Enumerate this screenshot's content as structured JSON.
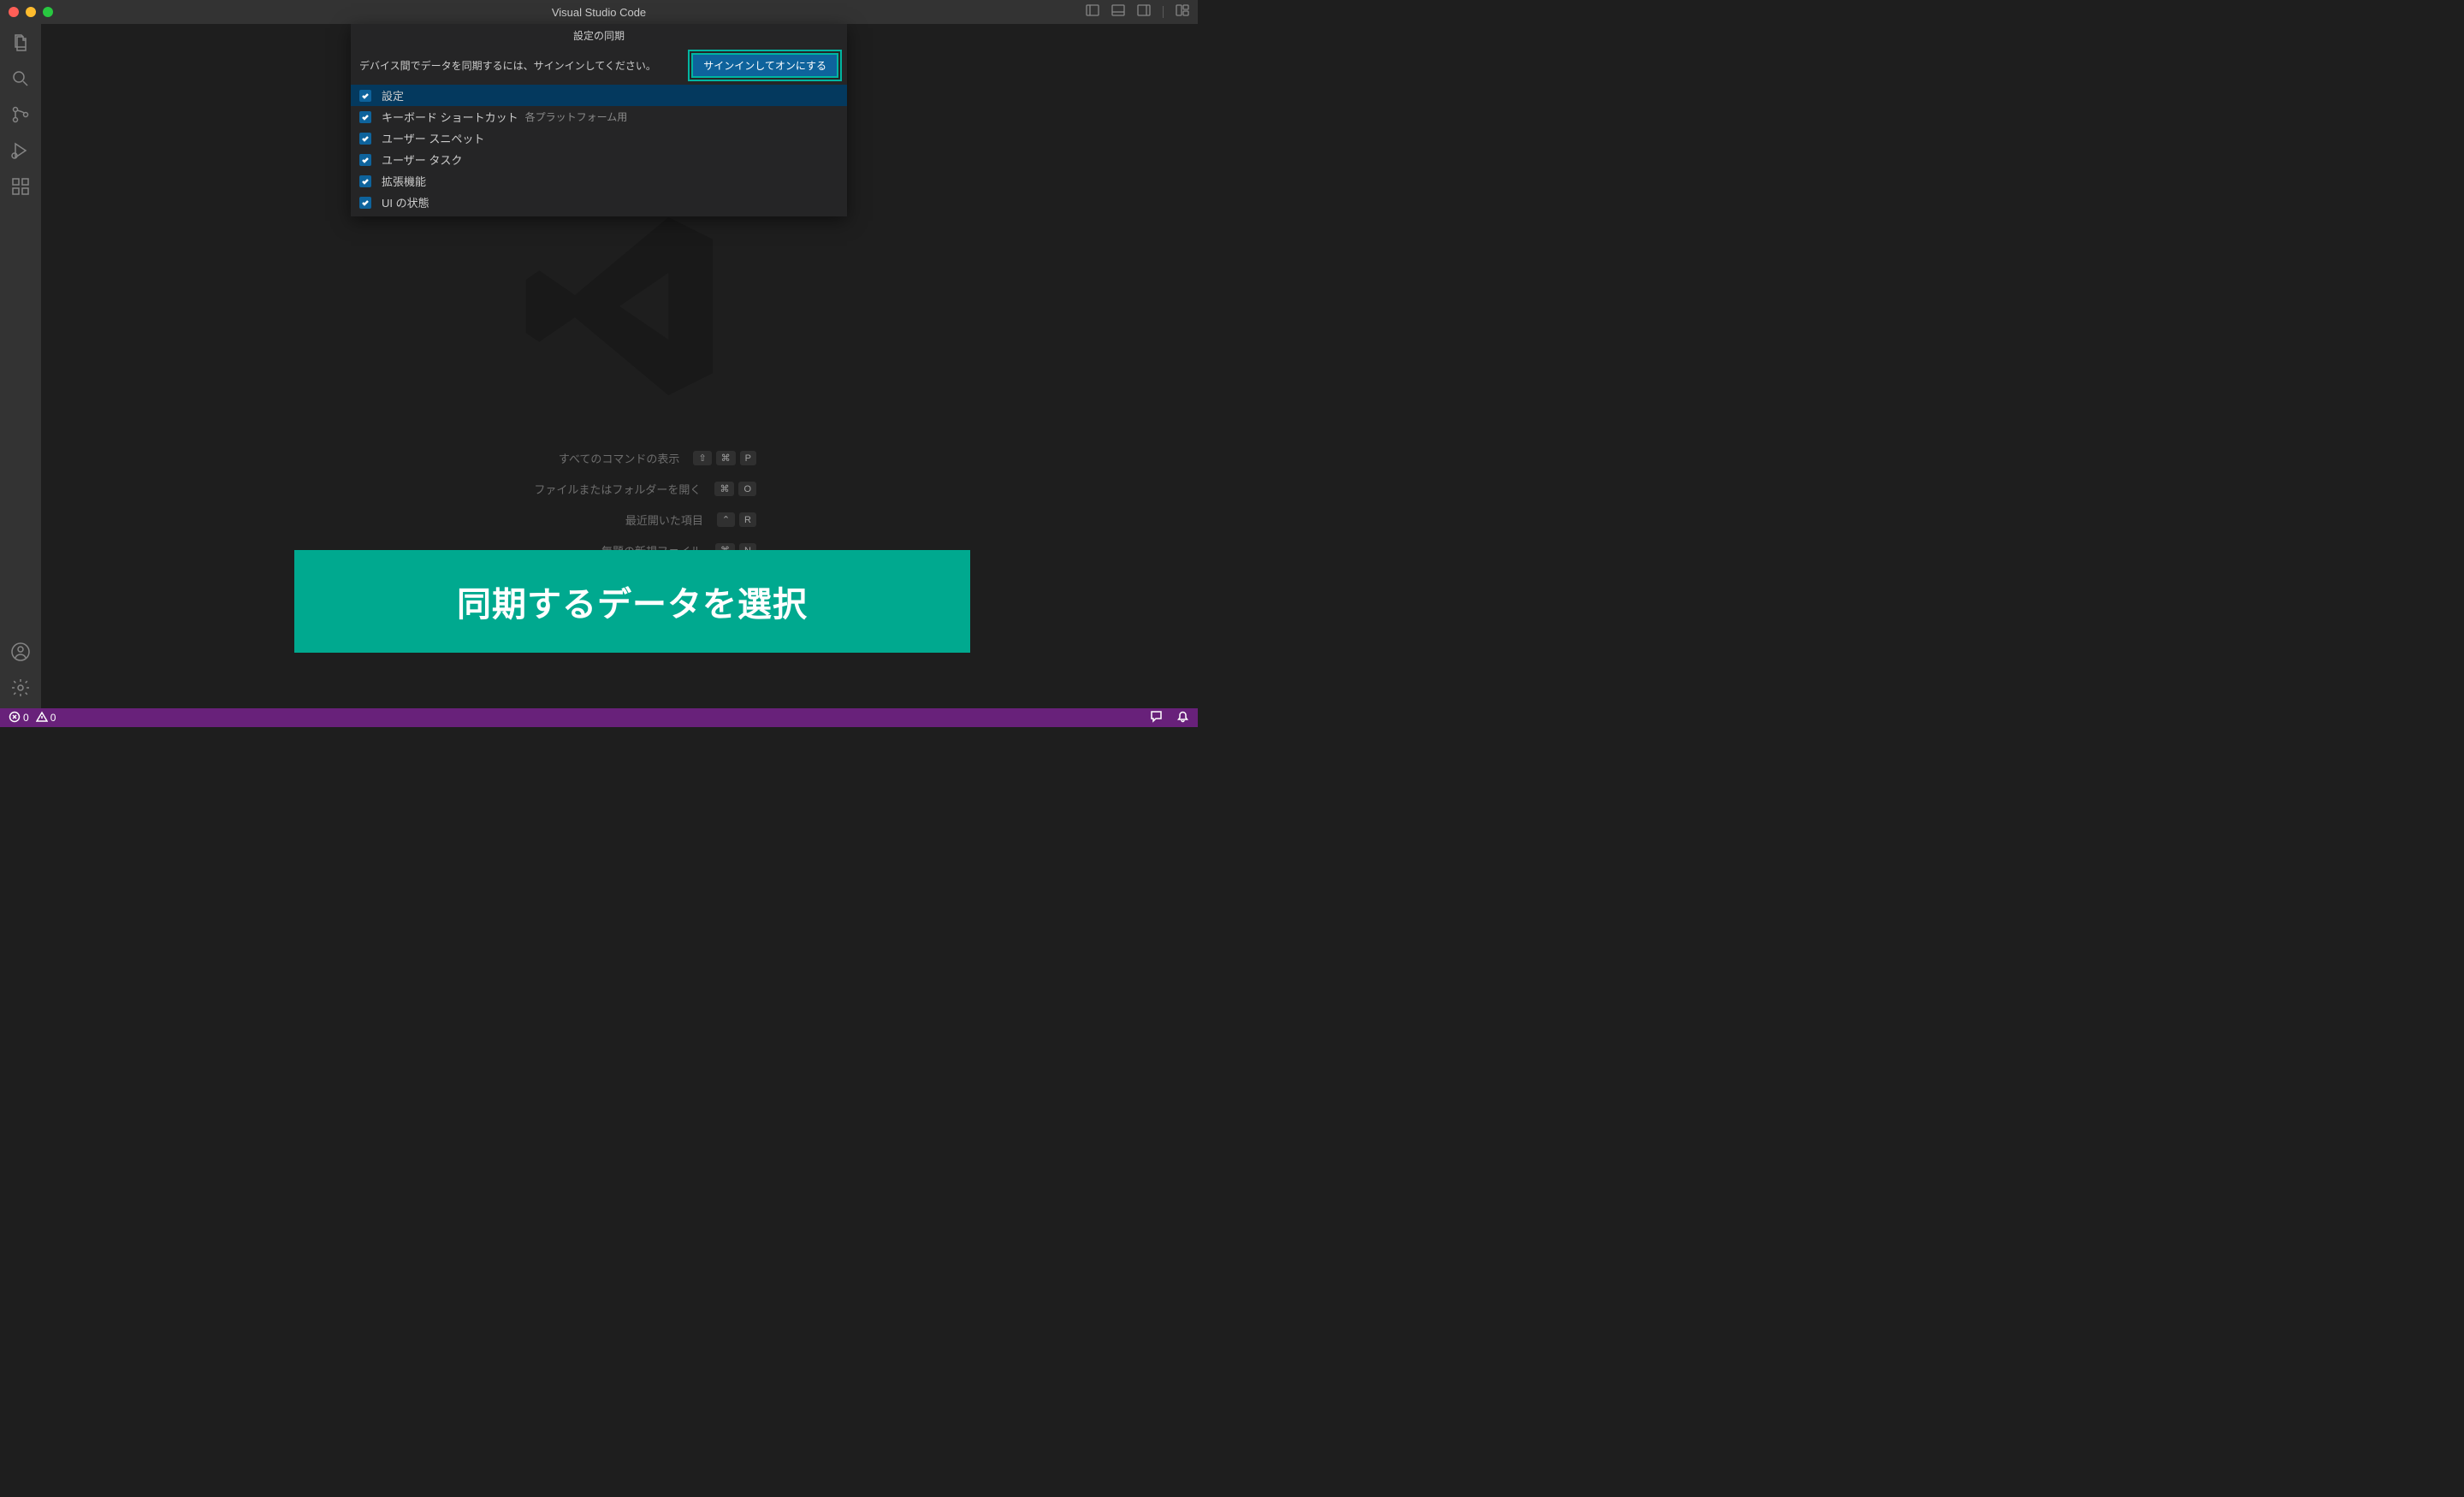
{
  "titlebar": {
    "title": "Visual Studio Code"
  },
  "quickinput": {
    "title": "設定の同期",
    "message": "デバイス間でデータを同期するには、サインインしてください。",
    "button": "サインインしてオンにする",
    "items": [
      {
        "label": "設定",
        "sublabel": "",
        "checked": true,
        "focused": true
      },
      {
        "label": "キーボード ショートカット",
        "sublabel": "各プラットフォーム用",
        "checked": true,
        "focused": false
      },
      {
        "label": "ユーザー スニペット",
        "sublabel": "",
        "checked": true,
        "focused": false
      },
      {
        "label": "ユーザー タスク",
        "sublabel": "",
        "checked": true,
        "focused": false
      },
      {
        "label": "拡張機能",
        "sublabel": "",
        "checked": true,
        "focused": false
      },
      {
        "label": "UI の状態",
        "sublabel": "",
        "checked": true,
        "focused": false
      }
    ]
  },
  "welcome": {
    "hints": [
      {
        "label": "すべてのコマンドの表示",
        "keys": [
          "⇧",
          "⌘",
          "P"
        ]
      },
      {
        "label": "ファイルまたはフォルダーを開く",
        "keys": [
          "⌘",
          "O"
        ]
      },
      {
        "label": "最近開いた項目",
        "keys": [
          "⌃",
          "R"
        ]
      },
      {
        "label": "無題の新規ファイル",
        "keys": [
          "⌘",
          "N"
        ]
      }
    ]
  },
  "banner": {
    "text": "同期するデータを選択"
  },
  "statusbar": {
    "errors": "0",
    "warnings": "0"
  },
  "colors": {
    "accent": "#00a98f",
    "statusbar": "#68217a",
    "buttonBg": "#0e639c"
  }
}
